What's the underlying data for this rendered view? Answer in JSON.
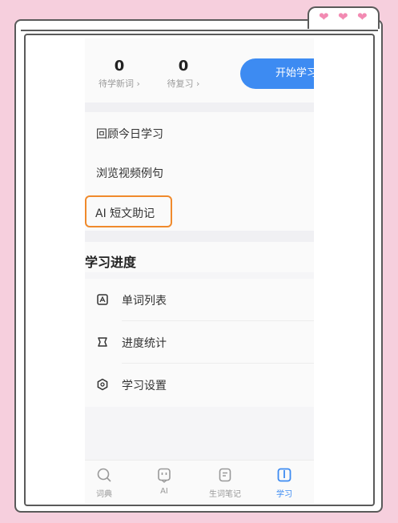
{
  "stats": [
    {
      "value": "0",
      "label": "待学新词 ›"
    },
    {
      "value": "0",
      "label": "待复习 ›"
    }
  ],
  "start_button": "开始学习",
  "review_items": [
    "回顾今日学习",
    "浏览视频例句"
  ],
  "ai_item": "AI 短文助记",
  "progress_section": {
    "title": "学习进度",
    "items": [
      {
        "label": "单词列表",
        "icon": "word-list-icon"
      },
      {
        "label": "进度统计",
        "icon": "stats-icon"
      },
      {
        "label": "学习设置",
        "icon": "settings-icon"
      }
    ]
  },
  "bottom_nav": [
    {
      "label": "词典",
      "icon": "dictionary-icon",
      "active": false
    },
    {
      "label": "AI",
      "icon": "ai-icon",
      "active": false
    },
    {
      "label": "生词笔记",
      "icon": "notes-icon",
      "active": false
    },
    {
      "label": "学习",
      "icon": "study-icon",
      "active": true
    }
  ],
  "colors": {
    "accent": "#3d8bf2",
    "highlight_box": "#f08a2c",
    "background_pink": "#f6cfdd",
    "heart": "#f28ab2"
  }
}
